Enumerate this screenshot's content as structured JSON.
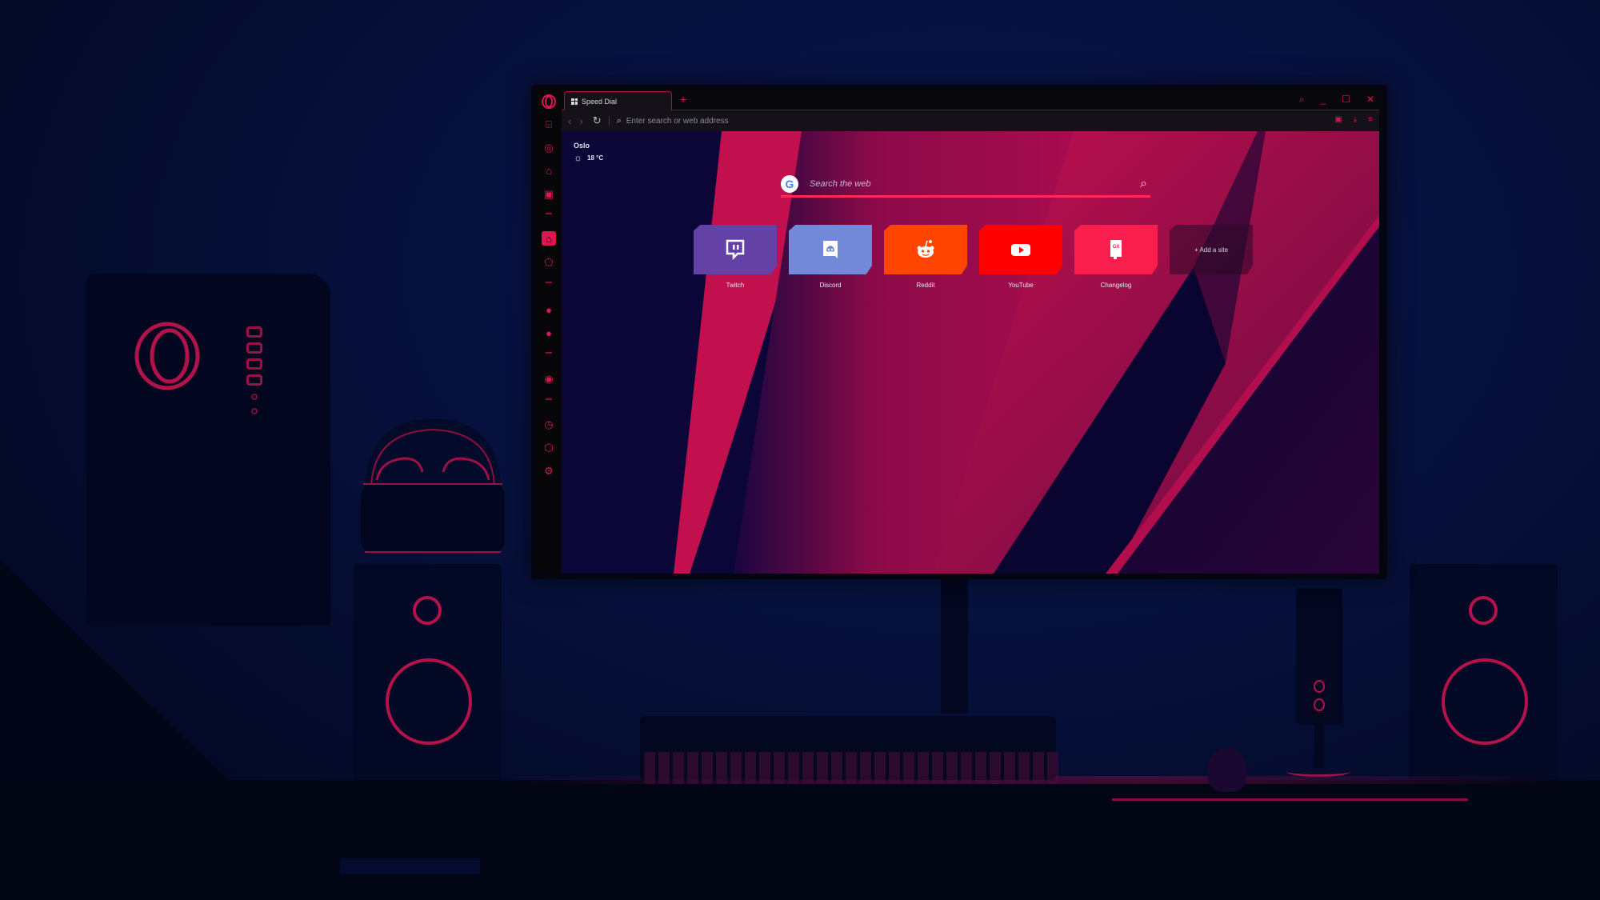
{
  "scene": {
    "description": "Dark neon gaming desk setup with PC tower, VR headset, speakers, keyboard, microphone"
  },
  "browser": {
    "tabs": [
      {
        "label": "Speed Dial",
        "active": true
      }
    ],
    "new_tab_label": "+",
    "address_bar": {
      "placeholder": "Enter search or web address"
    },
    "window_controls": [
      "search",
      "minimize",
      "maximize",
      "close"
    ]
  },
  "sidebar": {
    "items": [
      {
        "icon": "gamepad-icon",
        "glyph": "⌂"
      },
      {
        "icon": "gx-control-icon",
        "glyph": "◎"
      },
      {
        "icon": "gx-corner-icon",
        "glyph": "⌂"
      },
      {
        "icon": "twitch-icon",
        "glyph": "▣"
      },
      {
        "icon": "speed-dial-icon",
        "glyph": "⌂",
        "active": true
      },
      {
        "icon": "news-icon",
        "glyph": "⬠"
      },
      {
        "icon": "messenger-icon",
        "glyph": "●"
      },
      {
        "icon": "whatsapp-icon",
        "glyph": "●"
      },
      {
        "icon": "player-icon",
        "glyph": "◉"
      },
      {
        "icon": "history-icon",
        "glyph": "◷"
      },
      {
        "icon": "extensions-icon",
        "glyph": "⬡"
      },
      {
        "icon": "settings-icon",
        "glyph": "⚙"
      }
    ]
  },
  "weather": {
    "city": "Oslo",
    "temperature": "18 °C",
    "icon": "partly-cloudy-icon"
  },
  "search": {
    "engine": "Google",
    "placeholder": "Search the web"
  },
  "speed_dial": {
    "tiles": [
      {
        "label": "Twitch",
        "color": "#6441a5",
        "icon": "twitch-icon"
      },
      {
        "label": "Discord",
        "color": "#7289da",
        "icon": "discord-icon"
      },
      {
        "label": "Reddit",
        "color": "#ff4500",
        "icon": "reddit-icon"
      },
      {
        "label": "YouTube",
        "color": "#ff0000",
        "icon": "youtube-icon"
      },
      {
        "label": "Changelog",
        "color": "#fa1e4e",
        "icon": "changelog-icon",
        "badge": "GX"
      }
    ],
    "add_site_label": "+ Add a site"
  },
  "colors": {
    "accent": "#e0154f",
    "background": "#06103a",
    "wallpaper_red": "#c0104f"
  }
}
